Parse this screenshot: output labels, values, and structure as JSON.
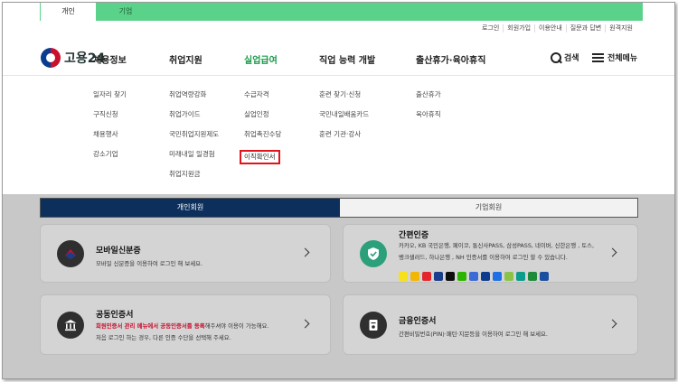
{
  "top_tabs": {
    "person": "개인",
    "corp": "기업"
  },
  "util_links": [
    "로그인",
    "회원가입",
    "이용안내",
    "질문과 답변",
    "원격지원"
  ],
  "logo": {
    "text": "고용24"
  },
  "gnb": {
    "items": [
      {
        "label": "채용정보"
      },
      {
        "label": "취업지원"
      },
      {
        "label": "실업급여"
      },
      {
        "label": "직업 능력 개발"
      },
      {
        "label": "출산휴가·육아휴직"
      }
    ],
    "search_label": "검색",
    "menu_label": "전체메뉴",
    "active_color": "#1b9a4a"
  },
  "submenu": {
    "col1": [
      "일자리 찾기",
      "구직신청",
      "채용행사",
      "강소기업"
    ],
    "col2": [
      "취업역량강화",
      "취업가이드",
      "국민취업지원제도",
      "미래내일 일경험",
      "취업지원금"
    ],
    "col3": [
      "수급자격",
      "실업인정",
      "취업촉진수당",
      "이직확인서"
    ],
    "col4": [
      "훈련 찾기·신청",
      "국민내일배움카드",
      "훈련 기관·강사"
    ],
    "col5": [
      "출산휴가",
      "육아휴직"
    ]
  },
  "member_tabs": {
    "person": "개인회원",
    "corp": "기업회원"
  },
  "cards": {
    "mobile_id": {
      "title": "모바일신분증",
      "desc": "모바일 신분증을 이용하여 로그인 해 보세요."
    },
    "simple_auth": {
      "title": "간편인증",
      "desc1": "카카오, KB 국민은행, 페이코, 통신사PASS, 삼성PASS, 네이버, 신한은행 , 토스,",
      "desc2": "뱅크샐러드, 하나은행 , NH 인증서를 이용하여 로그인 할 수 있습니다.",
      "provider_colors": [
        "#f7e01c",
        "#f2b705",
        "#e4262c",
        "#1a3e8c",
        "#0e0e0e",
        "#2db400",
        "#3c6bd6",
        "#0d3b8e",
        "#1f6fe5",
        "#8bc34a",
        "#0c9c8c",
        "#1f8a3a",
        "#1a4fa0"
      ]
    },
    "joint_cert": {
      "title": "공동인증서",
      "desc_red": "회원인증서 관리 메뉴에서 공동인증서를 등록",
      "desc_rest": "해주셔야 이용이 가능해요.",
      "desc2": "처음 로그인 하는 경우, 다른 인증 수단을 선택해 주세요."
    },
    "financial_cert": {
      "title": "금융인증서",
      "desc": "간편비밀번호(PIN)·패턴·지문등을 이용하여 로그인 해 보세요."
    }
  }
}
